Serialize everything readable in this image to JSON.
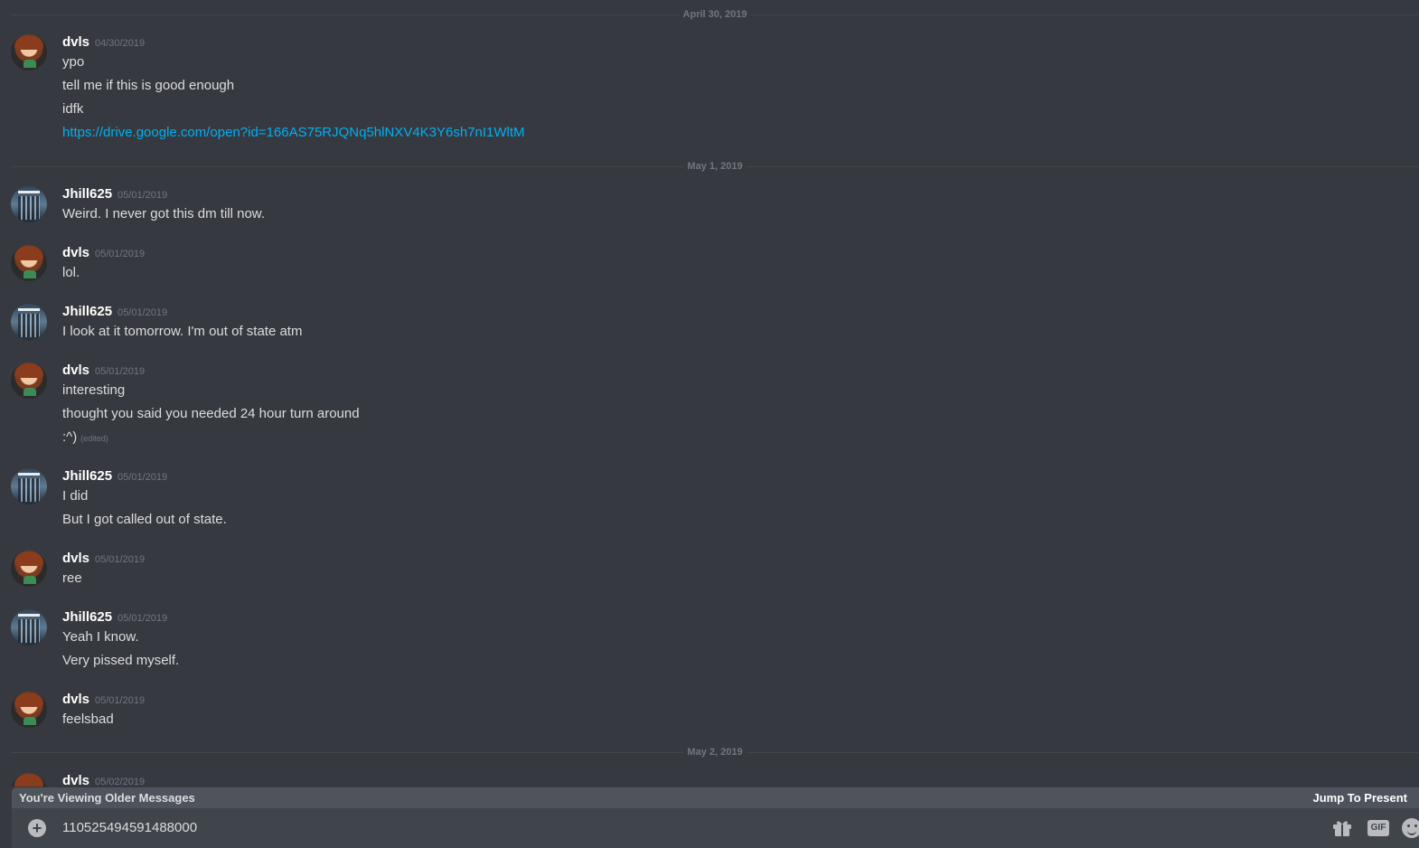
{
  "chat": {
    "dividers": [
      "April 30, 2019",
      "May 1, 2019",
      "May 2, 2019"
    ],
    "messages": [
      {
        "author": "dvls",
        "time": "04/30/2019",
        "lines": [
          "ypo",
          "tell me if this is good enough",
          "idfk"
        ],
        "link": "https://drive.google.com/open?id=166AS75RJQNq5hlNXV4K3Y6sh7nI1WltM"
      },
      {
        "author": "Jhill625",
        "time": "05/01/2019",
        "lines": [
          "Weird. I never got this dm till now."
        ]
      },
      {
        "author": "dvls",
        "time": "05/01/2019",
        "lines": [
          "lol."
        ]
      },
      {
        "author": "Jhill625",
        "time": "05/01/2019",
        "lines": [
          "I look at it tomorrow. I'm out of state atm"
        ]
      },
      {
        "author": "dvls",
        "time": "05/01/2019",
        "lines": [
          "interesting",
          "thought you said you needed 24 hour turn around",
          ":^)"
        ],
        "edited": "(edited)"
      },
      {
        "author": "Jhill625",
        "time": "05/01/2019",
        "lines": [
          "I did",
          "But I got called out of state."
        ]
      },
      {
        "author": "dvls",
        "time": "05/01/2019",
        "lines": [
          "ree"
        ]
      },
      {
        "author": "Jhill625",
        "time": "05/01/2019",
        "lines": [
          "Yeah I know.",
          "Very pissed myself."
        ]
      },
      {
        "author": "dvls",
        "time": "05/01/2019",
        "lines": [
          "feelsbad"
        ]
      },
      {
        "author": "dvls",
        "time": "05/02/2019",
        "lines": []
      }
    ]
  },
  "banner": {
    "notice": "You're Viewing Older Messages",
    "jump": "Jump To Present"
  },
  "composer": {
    "value": "110525494591488000",
    "gif_label": "GIF",
    "icons": [
      "plus-icon",
      "gift-icon",
      "gif-icon",
      "emoji-icon"
    ]
  }
}
